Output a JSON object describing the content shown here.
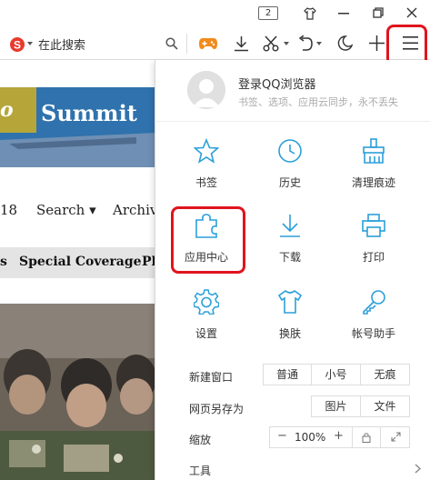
{
  "titlebar": {
    "tab_count": "2"
  },
  "toolbar": {
    "search_placeholder": "在此搜索",
    "icons": [
      "sogou-logo-icon",
      "search-icon",
      "gamepad-icon",
      "download-icon",
      "scissors-icon",
      "undo-icon",
      "moon-icon",
      "plus-icon",
      "menu-icon"
    ]
  },
  "page": {
    "banner_prefix": "o",
    "banner_word": "Summit",
    "nav": {
      "item_fragment": "18",
      "search": "Search ▾",
      "archive": "Archiv"
    },
    "strip": {
      "s": "s",
      "special": "Special Coverage",
      "ph": "Pl"
    }
  },
  "menu": {
    "login_title": "登录QQ浏览器",
    "login_sub": "书签、选项、应用云同步，永不丢失",
    "grid": [
      {
        "label": "书签",
        "icon": "star-icon"
      },
      {
        "label": "历史",
        "icon": "clock-icon"
      },
      {
        "label": "清理痕迹",
        "icon": "broom-icon"
      },
      {
        "label": "应用中心",
        "icon": "puzzle-icon"
      },
      {
        "label": "下载",
        "icon": "download-icon"
      },
      {
        "label": "打印",
        "icon": "printer-icon"
      },
      {
        "label": "设置",
        "icon": "gear-icon"
      },
      {
        "label": "换肤",
        "icon": "tshirt-icon"
      },
      {
        "label": "帐号助手",
        "icon": "key-icon"
      }
    ],
    "new_window": {
      "label": "新建窗口",
      "options": [
        "普通",
        "小号",
        "无痕"
      ]
    },
    "save_page": {
      "label": "网页另存为",
      "options": [
        "图片",
        "文件"
      ]
    },
    "zoom": {
      "label": "缩放",
      "minus": "−",
      "value": "100%",
      "plus": "+"
    },
    "tools": {
      "label": "工具"
    }
  },
  "colors": {
    "accent": "#2b9fd9",
    "highlight": "#e0141e",
    "banner": "#2e6fa7"
  }
}
